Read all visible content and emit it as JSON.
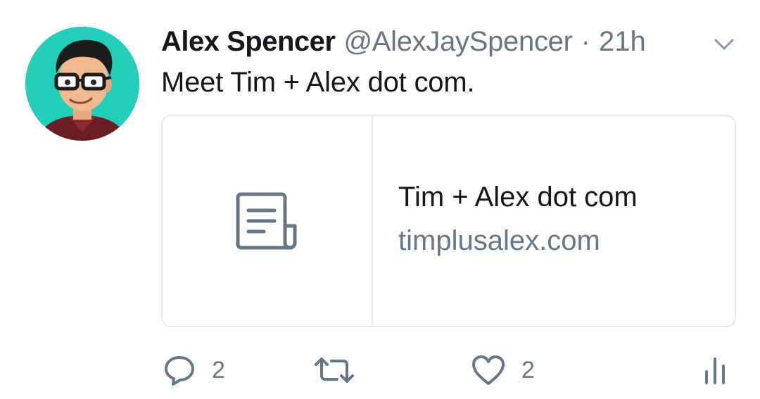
{
  "tweet": {
    "author_name": "Alex Spencer",
    "author_handle": "@AlexJaySpencer",
    "separator": "·",
    "time": "21h",
    "text": "Meet Tim + Alex dot com."
  },
  "card": {
    "title": "Tim + Alex dot com",
    "domain": "timplusalex.com",
    "thumb_icon": "document-icon"
  },
  "actions": {
    "reply_count": "2",
    "retweet_count": "",
    "like_count": "2"
  },
  "colors": {
    "text_primary": "#14171a",
    "text_secondary": "#657786",
    "card_border": "#e1e8ed",
    "avatar_bg": "#22cdb9"
  }
}
